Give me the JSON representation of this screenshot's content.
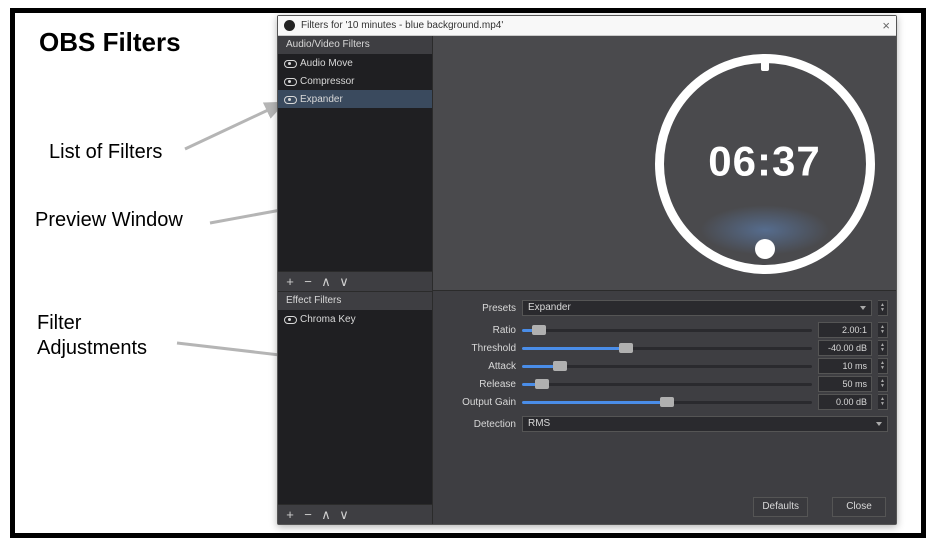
{
  "slide": {
    "title": "OBS Filters",
    "label_list": "List of Filters",
    "label_preview": "Preview Window",
    "label_adjust": "Filter\nAdjustments"
  },
  "dialog": {
    "title": "Filters for '10 minutes - blue background.mp4'",
    "close_glyph": "×",
    "av_header": "Audio/Video Filters",
    "av_filters": [
      {
        "name": "Audio Move",
        "selected": false
      },
      {
        "name": "Compressor",
        "selected": false
      },
      {
        "name": "Expander",
        "selected": true
      }
    ],
    "ef_header": "Effect Filters",
    "ef_filters": [
      {
        "name": "Chroma Key",
        "selected": false
      }
    ],
    "toolbar": {
      "add": "+",
      "remove": "−",
      "up": "∧",
      "down": "∨"
    },
    "preview_time": "06:37",
    "settings": {
      "preset_label": "Presets",
      "preset_value": "Expander",
      "params": [
        {
          "label": "Ratio",
          "value": "2.00:1",
          "pct": 6
        },
        {
          "label": "Threshold",
          "value": "-40.00 dB",
          "pct": 36
        },
        {
          "label": "Attack",
          "value": "10 ms",
          "pct": 13
        },
        {
          "label": "Release",
          "value": "50 ms",
          "pct": 7
        },
        {
          "label": "Output Gain",
          "value": "0.00 dB",
          "pct": 50
        }
      ],
      "detection_label": "Detection",
      "detection_value": "RMS"
    },
    "buttons": {
      "defaults": "Defaults",
      "close": "Close"
    }
  }
}
